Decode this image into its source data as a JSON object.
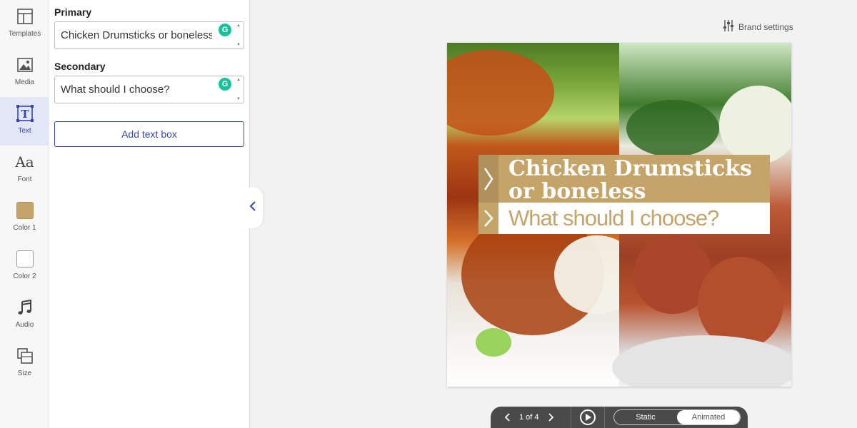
{
  "rail": {
    "items": [
      {
        "label": "Templates",
        "icon": "templates-icon",
        "active": false
      },
      {
        "label": "Media",
        "icon": "media-icon",
        "active": false
      },
      {
        "label": "Text",
        "icon": "text-icon",
        "active": true
      },
      {
        "label": "Font",
        "icon": "font-icon",
        "active": false
      },
      {
        "label": "Color 1",
        "icon": "color1-swatch",
        "active": false
      },
      {
        "label": "Color 2",
        "icon": "color2-swatch",
        "active": false
      },
      {
        "label": "Audio",
        "icon": "audio-icon",
        "active": false
      },
      {
        "label": "Size",
        "icon": "size-icon",
        "active": false
      }
    ],
    "font_glyph": "Aa",
    "text_glyph": "T"
  },
  "panel": {
    "primary": {
      "label": "Primary",
      "value": "Chicken Drumsticks or boneless"
    },
    "secondary": {
      "label": "Secondary",
      "value": "What should I choose?"
    },
    "add_text_box": "Add text box"
  },
  "brand_settings": "Brand settings",
  "canvas": {
    "title": "Chicken Drumsticks or boneless",
    "subtitle": "What should I choose?"
  },
  "player": {
    "page_indicator": "1 of 4",
    "static_label": "Static",
    "animated_label": "Animated",
    "selected_mode": "Animated"
  },
  "colors": {
    "accent": "#3346b3",
    "color1": "#c5a46a",
    "color2": "#ffffff",
    "grammarly": "#15c39a",
    "player_bg": "#4a4a4a"
  }
}
